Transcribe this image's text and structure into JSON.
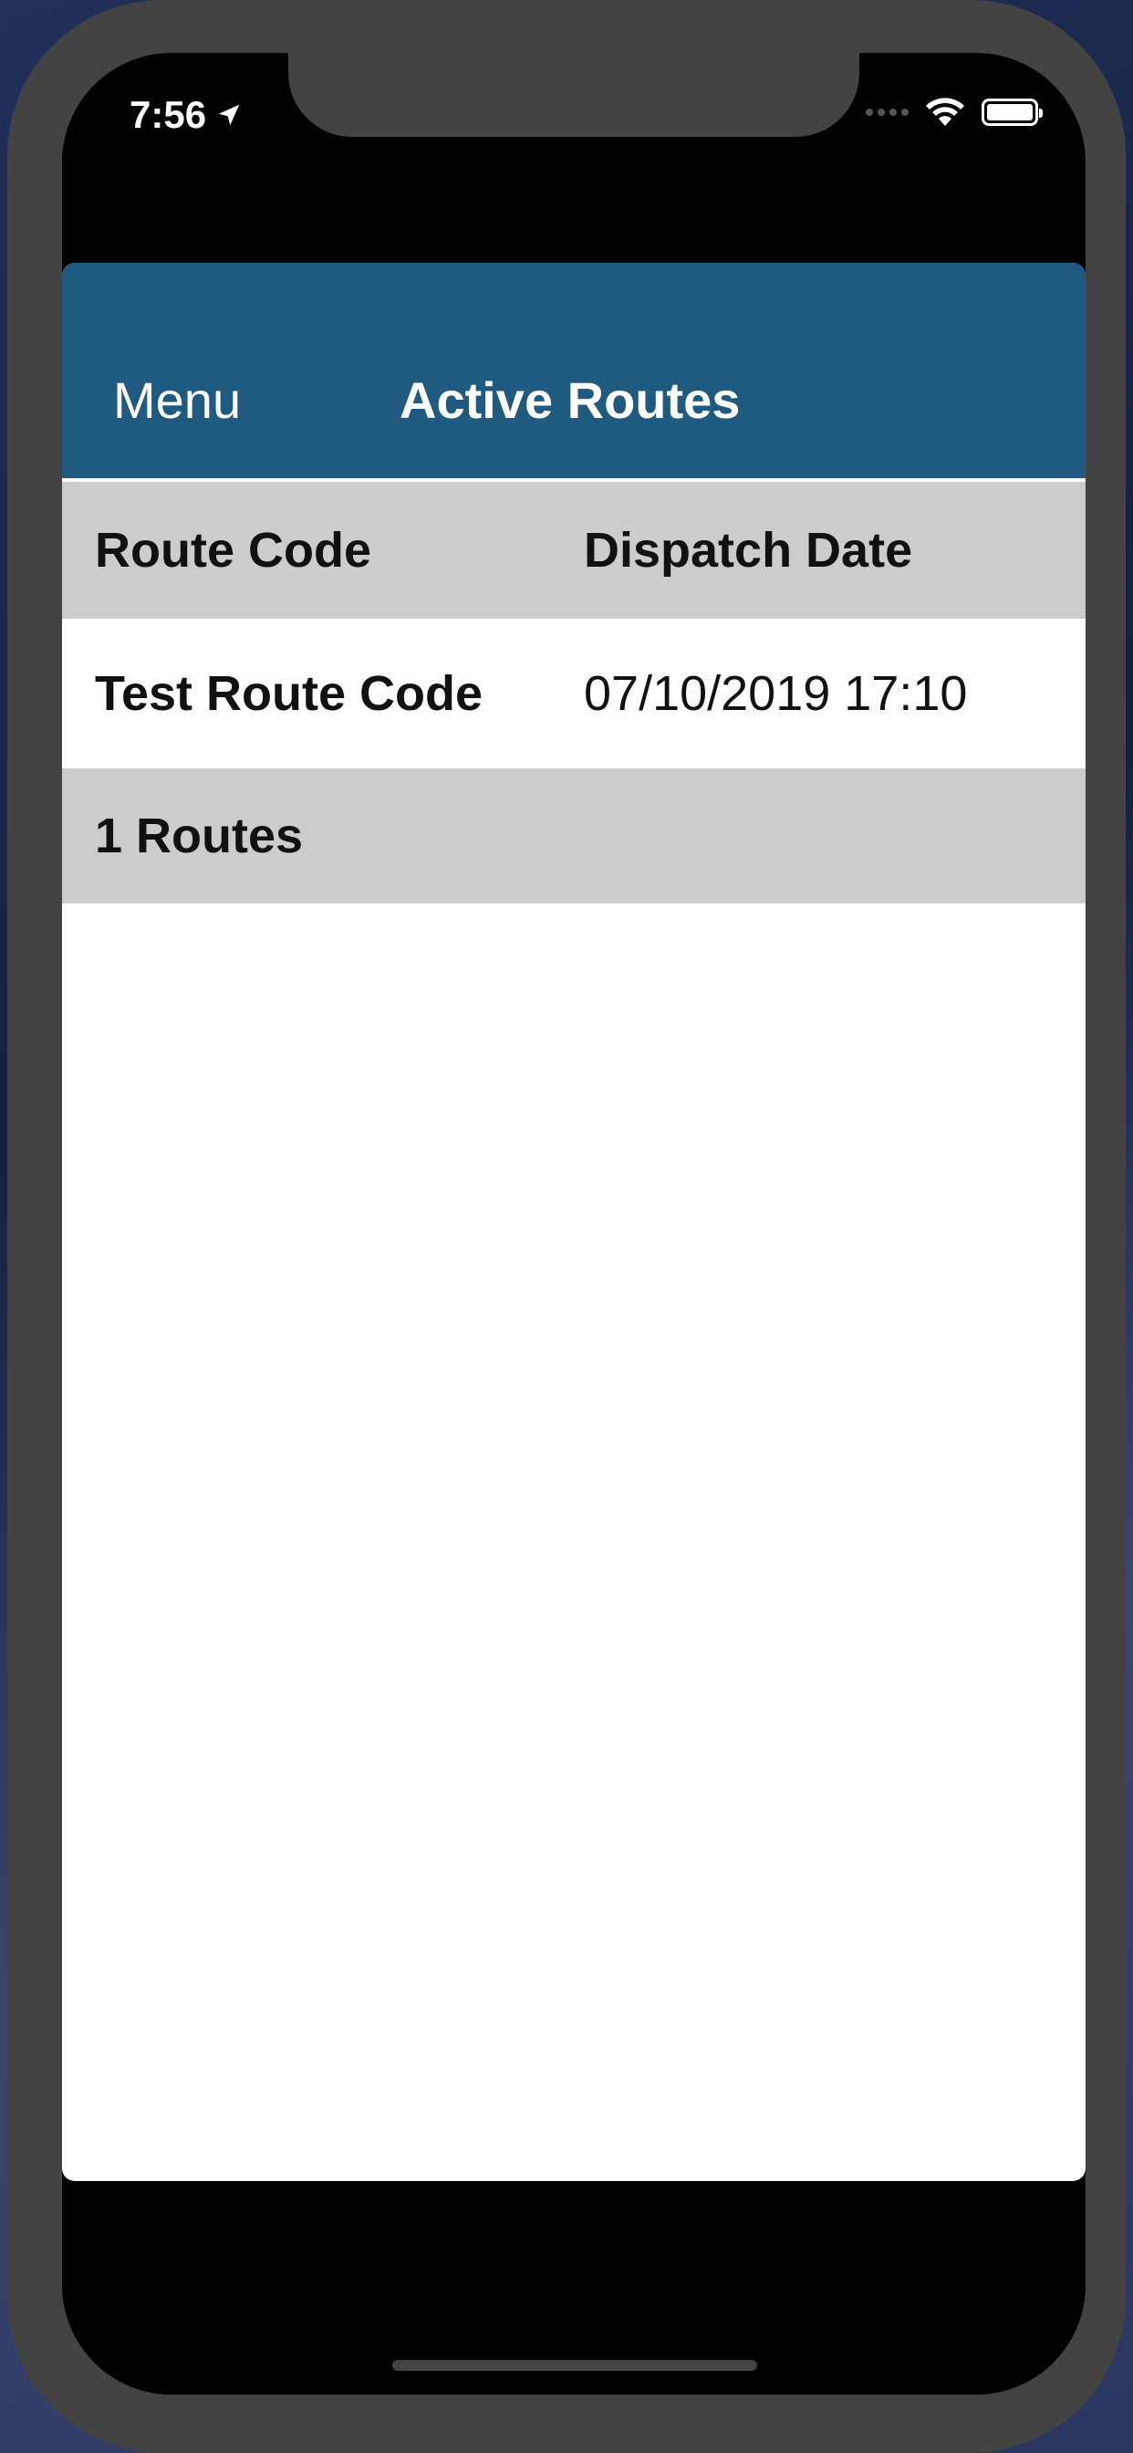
{
  "status_bar": {
    "time": "7:56",
    "location_icon": "location-arrow-icon",
    "wifi_icon": "wifi-icon",
    "battery_icon": "battery-icon"
  },
  "nav": {
    "menu_label": "Menu",
    "title": "Active Routes"
  },
  "table": {
    "headers": [
      "Route Code",
      "Dispatch Date"
    ],
    "rows": [
      {
        "route_code": "Test Route Code",
        "dispatch_date": "07/10/2019 17:10"
      }
    ],
    "footer": "1 Routes"
  },
  "colors": {
    "nav_background": "#1f5b80",
    "section_background": "#cccccc"
  }
}
